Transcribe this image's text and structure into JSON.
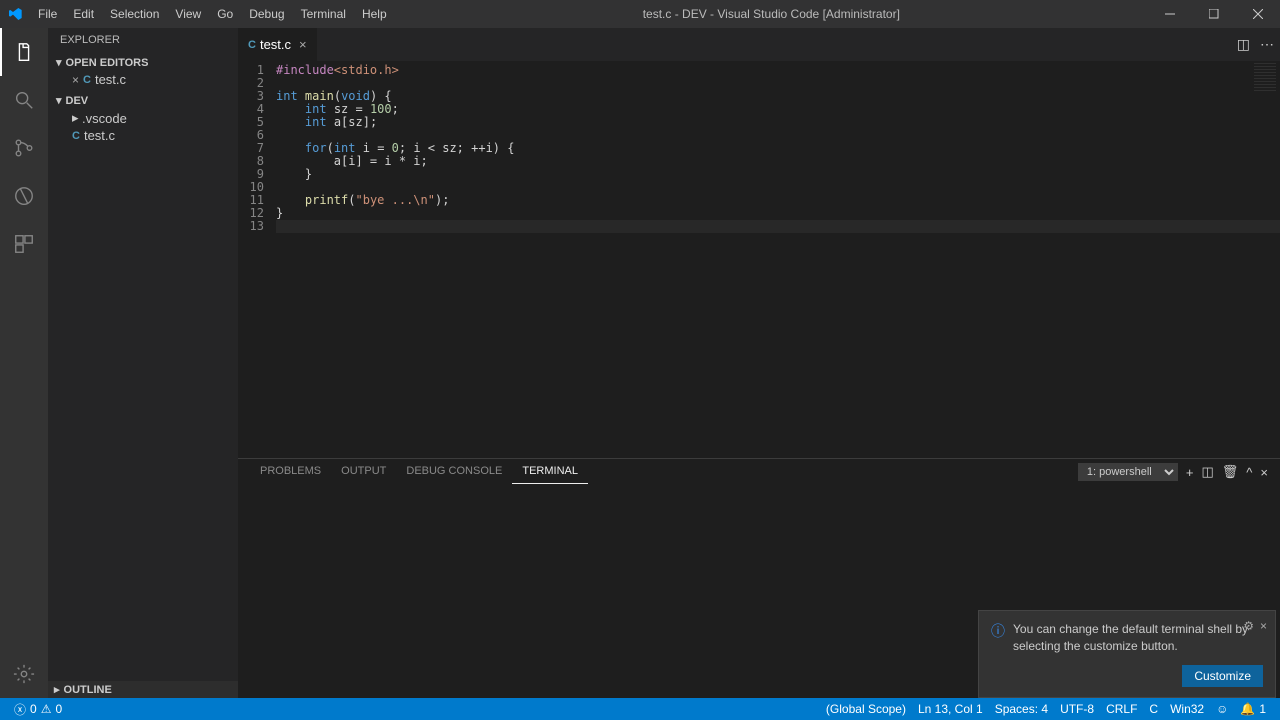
{
  "titlebar": {
    "menus": [
      "File",
      "Edit",
      "Selection",
      "View",
      "Go",
      "Debug",
      "Terminal",
      "Help"
    ],
    "title": "test.c - DEV - Visual Studio Code [Administrator]"
  },
  "sidebar": {
    "title": "Explorer",
    "open_editors_label": "Open Editors",
    "open_editors": [
      {
        "name": "test.c"
      }
    ],
    "workspace_label": "DEV",
    "workspace_items": [
      {
        "name": ".vscode",
        "type": "folder"
      },
      {
        "name": "test.c",
        "type": "cfile"
      }
    ],
    "outline_label": "Outline"
  },
  "tabs": [
    {
      "name": "test.c"
    }
  ],
  "editor": {
    "line_numbers": [
      "1",
      "2",
      "3",
      "4",
      "5",
      "6",
      "7",
      "8",
      "9",
      "10",
      "11",
      "12",
      "13"
    ],
    "code": {
      "l1_pp": "#include",
      "l1_hdr": "<stdio.h>",
      "l3_int": "int",
      "l3_main": "main",
      "l3_void": "void",
      "l4_int": "int",
      "l4_rest": " sz = ",
      "l4_num": "100",
      "l5_int": "int",
      "l5_rest": " a[sz];",
      "l7_for": "for",
      "l7_int": "int",
      "l7_rest1": " i = ",
      "l7_num0": "0",
      "l7_rest2": "; i < sz; ++i) {",
      "l8": "a[i] = i * i;",
      "l9": "}",
      "l11_fn": "printf",
      "l11_str": "\"bye ...\\n\"",
      "l12": "}"
    }
  },
  "panel": {
    "tabs": [
      "Problems",
      "Output",
      "Debug Console",
      "Terminal"
    ],
    "active_tab": 3,
    "terminal_selected": "1: powershell"
  },
  "notification": {
    "text": "You can change the default terminal shell by selecting the customize button.",
    "button": "Customize"
  },
  "statusbar": {
    "errors": "0",
    "warnings": "0",
    "right": [
      "(Global Scope)",
      "Ln 13, Col 1",
      "Spaces: 4",
      "UTF-8",
      "CRLF",
      "C",
      "Win32"
    ],
    "smile": "☺",
    "bell": "🔔",
    "bell_count": "1"
  }
}
